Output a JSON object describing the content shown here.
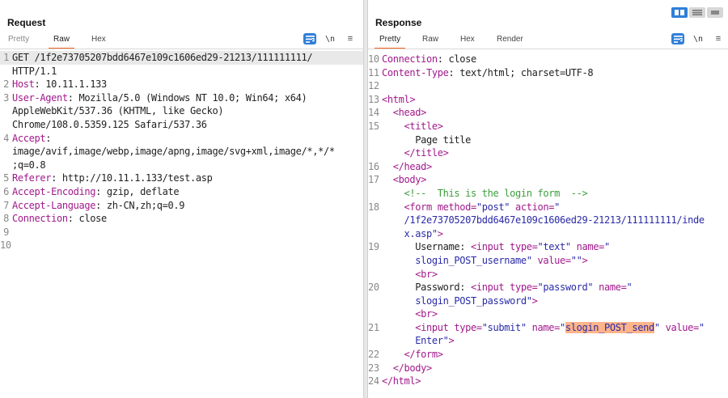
{
  "request": {
    "title": "Request",
    "tabs": [
      "Pretty",
      "Raw",
      "Hex"
    ],
    "active_tab": "Raw",
    "newline_toggle": "\\n",
    "menu_glyph": "≡",
    "lines": [
      {
        "n": "1",
        "parts": [
          {
            "t": "GET /1f2e73705207bdd6467e109c1606ed29-21213/111111111/",
            "c": ""
          }
        ],
        "selected": true
      },
      {
        "n": "",
        "parts": [
          {
            "t": "HTTP/1.1",
            "c": ""
          }
        ]
      },
      {
        "n": "2",
        "parts": [
          {
            "t": "Host",
            "c": "hname"
          },
          {
            "t": ": 10.11.1.133",
            "c": ""
          }
        ]
      },
      {
        "n": "3",
        "parts": [
          {
            "t": "User-Agent",
            "c": "hname"
          },
          {
            "t": ": Mozilla/5.0 (Windows NT 10.0; Win64; x64)",
            "c": ""
          }
        ]
      },
      {
        "n": "",
        "parts": [
          {
            "t": "AppleWebKit/537.36 (KHTML, like Gecko)",
            "c": ""
          }
        ]
      },
      {
        "n": "",
        "parts": [
          {
            "t": "Chrome/108.0.5359.125 Safari/537.36",
            "c": ""
          }
        ]
      },
      {
        "n": "4",
        "parts": [
          {
            "t": "Accept",
            "c": "hname"
          },
          {
            "t": ":",
            "c": ""
          }
        ]
      },
      {
        "n": "",
        "parts": [
          {
            "t": "image/avif,image/webp,image/apng,image/svg+xml,image/*,*/*",
            "c": ""
          }
        ]
      },
      {
        "n": "",
        "parts": [
          {
            "t": ";q=0.8",
            "c": ""
          }
        ]
      },
      {
        "n": "5",
        "parts": [
          {
            "t": "Referer",
            "c": "hname"
          },
          {
            "t": ": http://10.11.1.133/test.asp",
            "c": ""
          }
        ]
      },
      {
        "n": "6",
        "parts": [
          {
            "t": "Accept-Encoding",
            "c": "hname"
          },
          {
            "t": ": gzip, deflate",
            "c": ""
          }
        ]
      },
      {
        "n": "7",
        "parts": [
          {
            "t": "Accept-Language",
            "c": "hname"
          },
          {
            "t": ": zh-CN,zh;q=0.9",
            "c": ""
          }
        ]
      },
      {
        "n": "8",
        "parts": [
          {
            "t": "Connection",
            "c": "hname"
          },
          {
            "t": ": close",
            "c": ""
          }
        ]
      },
      {
        "n": "9",
        "parts": []
      },
      {
        "n": "10",
        "parts": []
      }
    ]
  },
  "response": {
    "title": "Response",
    "tabs": [
      "Pretty",
      "Raw",
      "Hex",
      "Render"
    ],
    "active_tab": "Pretty",
    "newline_toggle": "\\n",
    "menu_glyph": "≡",
    "lines": [
      {
        "n": "10",
        "parts": [
          {
            "t": "Connection",
            "c": "hname"
          },
          {
            "t": ": close",
            "c": ""
          }
        ]
      },
      {
        "n": "11",
        "parts": [
          {
            "t": "Content-Type",
            "c": "hname"
          },
          {
            "t": ": text/html; charset=UTF-8",
            "c": ""
          }
        ]
      },
      {
        "n": "12",
        "parts": []
      },
      {
        "n": "13",
        "parts": [
          {
            "t": "<html>",
            "c": "tag"
          }
        ]
      },
      {
        "n": "14",
        "parts": [
          {
            "t": "  ",
            "c": ""
          },
          {
            "t": "<head>",
            "c": "tag"
          }
        ]
      },
      {
        "n": "15",
        "parts": [
          {
            "t": "    ",
            "c": ""
          },
          {
            "t": "<title>",
            "c": "tag"
          }
        ]
      },
      {
        "n": "",
        "parts": [
          {
            "t": "      Page title",
            "c": ""
          }
        ]
      },
      {
        "n": "",
        "parts": [
          {
            "t": "    ",
            "c": ""
          },
          {
            "t": "</title>",
            "c": "tag"
          }
        ]
      },
      {
        "n": "16",
        "parts": [
          {
            "t": "  ",
            "c": ""
          },
          {
            "t": "</head>",
            "c": "tag"
          }
        ]
      },
      {
        "n": "17",
        "parts": [
          {
            "t": "  ",
            "c": ""
          },
          {
            "t": "<body>",
            "c": "tag"
          }
        ]
      },
      {
        "n": "",
        "parts": [
          {
            "t": "    ",
            "c": ""
          },
          {
            "t": "<!--  This is the login form  -->",
            "c": "cmt"
          }
        ]
      },
      {
        "n": "18",
        "parts": [
          {
            "t": "    ",
            "c": ""
          },
          {
            "t": "<form ",
            "c": "tag"
          },
          {
            "t": "method=",
            "c": "attr"
          },
          {
            "t": "\"post\" ",
            "c": "str"
          },
          {
            "t": "action=",
            "c": "attr"
          },
          {
            "t": "\"",
            "c": "str"
          }
        ]
      },
      {
        "n": "",
        "parts": [
          {
            "t": "    /1f2e73705207bdd6467e109c1606ed29-21213/111111111/inde",
            "c": "str"
          }
        ]
      },
      {
        "n": "",
        "parts": [
          {
            "t": "    x.asp\"",
            "c": "str"
          },
          {
            "t": ">",
            "c": "tag"
          }
        ]
      },
      {
        "n": "19",
        "parts": [
          {
            "t": "      Username: ",
            "c": ""
          },
          {
            "t": "<input ",
            "c": "tag"
          },
          {
            "t": "type=",
            "c": "attr"
          },
          {
            "t": "\"text\" ",
            "c": "str"
          },
          {
            "t": "name=",
            "c": "attr"
          },
          {
            "t": "\"",
            "c": "str"
          }
        ]
      },
      {
        "n": "",
        "parts": [
          {
            "t": "      slogin_POST_username\" ",
            "c": "str"
          },
          {
            "t": "value=",
            "c": "attr"
          },
          {
            "t": "\"\"",
            "c": "str"
          },
          {
            "t": ">",
            "c": "tag"
          }
        ]
      },
      {
        "n": "",
        "parts": [
          {
            "t": "      ",
            "c": ""
          },
          {
            "t": "<br>",
            "c": "tag"
          }
        ]
      },
      {
        "n": "20",
        "parts": [
          {
            "t": "      Password: ",
            "c": ""
          },
          {
            "t": "<input ",
            "c": "tag"
          },
          {
            "t": "type=",
            "c": "attr"
          },
          {
            "t": "\"password\" ",
            "c": "str"
          },
          {
            "t": "name=",
            "c": "attr"
          },
          {
            "t": "\"",
            "c": "str"
          }
        ]
      },
      {
        "n": "",
        "parts": [
          {
            "t": "      slogin_POST_password\"",
            "c": "str"
          },
          {
            "t": ">",
            "c": "tag"
          }
        ]
      },
      {
        "n": "",
        "parts": [
          {
            "t": "      ",
            "c": ""
          },
          {
            "t": "<br>",
            "c": "tag"
          }
        ]
      },
      {
        "n": "21",
        "parts": [
          {
            "t": "      ",
            "c": ""
          },
          {
            "t": "<input ",
            "c": "tag"
          },
          {
            "t": "type=",
            "c": "attr"
          },
          {
            "t": "\"submit\" ",
            "c": "str"
          },
          {
            "t": "name=",
            "c": "attr"
          },
          {
            "t": "\"",
            "c": "str"
          },
          {
            "t": "slogin_POST_send",
            "c": "str hl"
          },
          {
            "t": "\" ",
            "c": "str"
          },
          {
            "t": "value=",
            "c": "attr"
          },
          {
            "t": "\"",
            "c": "str"
          }
        ]
      },
      {
        "n": "",
        "parts": [
          {
            "t": "      Enter\"",
            "c": "str"
          },
          {
            "t": ">",
            "c": "tag"
          }
        ]
      },
      {
        "n": "22",
        "parts": [
          {
            "t": "    ",
            "c": ""
          },
          {
            "t": "</form>",
            "c": "tag"
          }
        ]
      },
      {
        "n": "23",
        "parts": [
          {
            "t": "  ",
            "c": ""
          },
          {
            "t": "</body>",
            "c": "tag"
          }
        ]
      },
      {
        "n": "24",
        "parts": [
          {
            "t": "</html>",
            "c": "tag"
          }
        ]
      }
    ]
  },
  "colors": {
    "accent_tab_underline": "#f26522",
    "blue_button": "#2f7fd8",
    "header_name": "#a1198b",
    "string": "#2a2aa8",
    "comment": "#3b9e3b",
    "search_highlight": "#ffb48a"
  },
  "icons": {
    "wrap_toggle": "wrap-lines-icon",
    "layout_side": "layout-side-by-side-icon",
    "layout_top": "layout-top-bottom-icon",
    "layout_single": "layout-single-icon"
  }
}
